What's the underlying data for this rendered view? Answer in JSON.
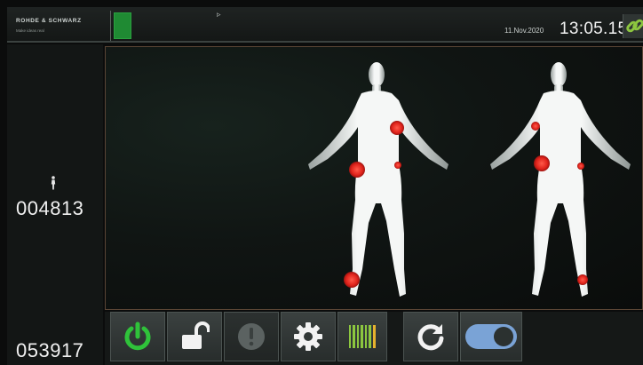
{
  "header": {
    "brand": "ROHDE & SCHWARZ",
    "brand_sub": "Make ideas real",
    "date": "11.Nov.2020",
    "time": "13:05.15"
  },
  "counters": {
    "top": "004813",
    "bottom": "053917"
  },
  "scan": {
    "alarm_color": "#e8261f",
    "front_alarms": 4,
    "back_alarms": 4
  },
  "toolbar": {
    "icons": [
      "power-icon",
      "unlock-icon",
      "alert-icon",
      "settings-icon",
      "barcode-icon",
      "refresh-icon",
      "toggle-switch"
    ],
    "power_color": "#2fc23a",
    "toggle_state": "on"
  }
}
